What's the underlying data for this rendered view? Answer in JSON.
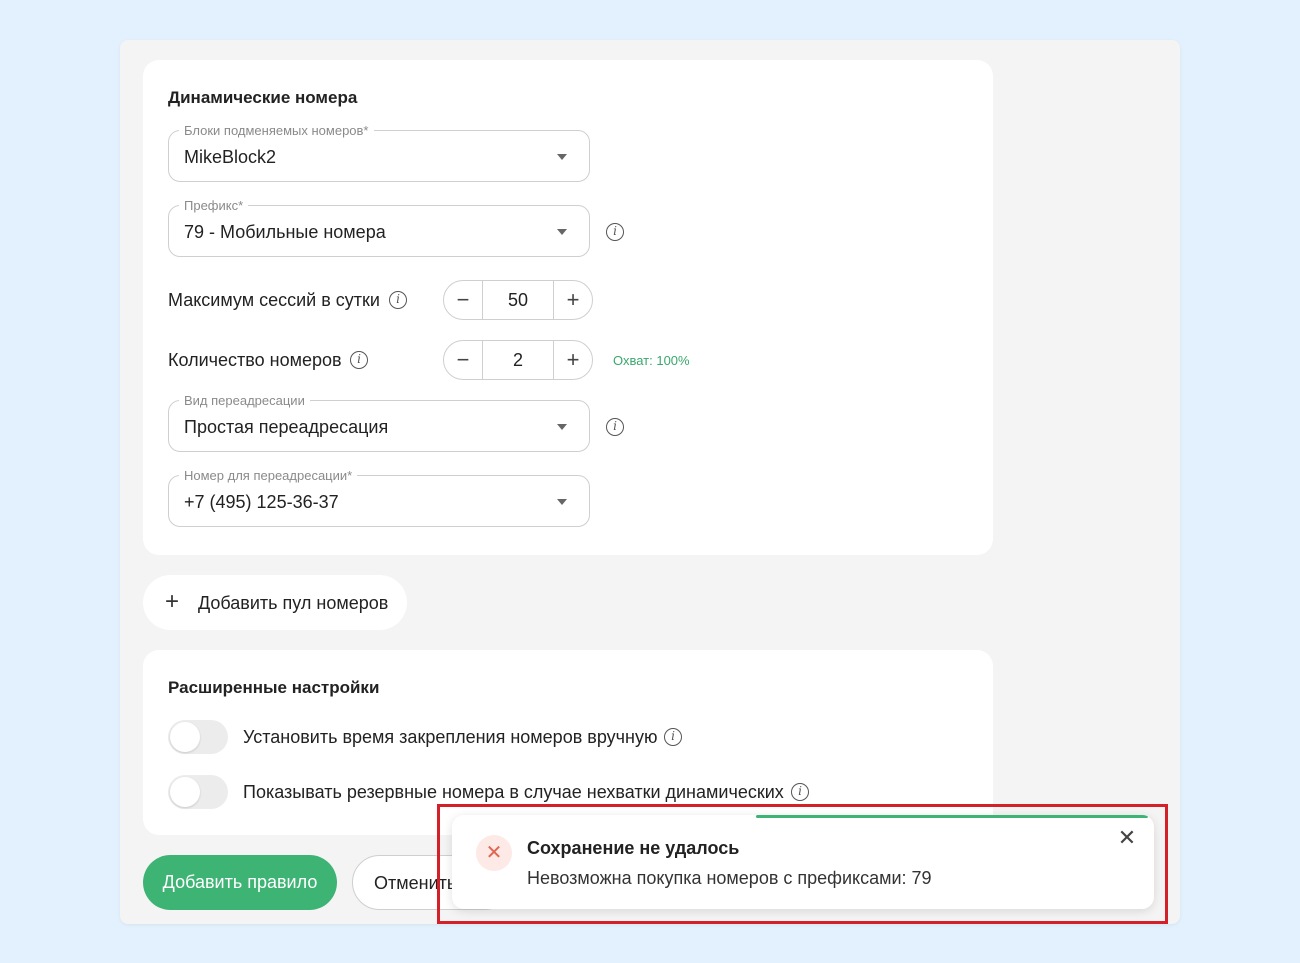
{
  "dynamic_section": {
    "title": "Динамические номера",
    "blocks_field": {
      "label": "Блоки подменяемых номеров*",
      "value": "MikeBlock2"
    },
    "prefix_field": {
      "label": "Префикс*",
      "value": "79 - Мобильные номера"
    },
    "max_sessions": {
      "label": "Максимум сессий в сутки",
      "value": "50"
    },
    "numbers_count": {
      "label": "Количество номеров",
      "value": "2",
      "coverage": "Охват: 100%"
    },
    "forward_type_field": {
      "label": "Вид переадресации",
      "value": "Простая переадресация"
    },
    "forward_number_field": {
      "label": "Номер для переадресации*",
      "value": "+7 (495) 125-36-37"
    }
  },
  "add_pool_label": "Добавить пул номеров",
  "advanced_section": {
    "title": "Расширенные настройки",
    "toggle_pin_time": {
      "label": "Установить время закрепления номеров вручную",
      "on": false
    },
    "toggle_reserve": {
      "label": "Показывать резервные номера в случае нехватки динамических",
      "on": false
    }
  },
  "actions": {
    "add_rule": "Добавить правило",
    "cancel": "Отменить"
  },
  "toast": {
    "title": "Сохранение не удалось",
    "message": "Невозможна покупка номеров с префиксами: 79",
    "progress_remaining": 0.57
  },
  "colors": {
    "accent": "#3db374",
    "error": "#e06650",
    "highlight": "#d32029",
    "background": "#e3f0fd"
  },
  "icons": {
    "info": "info-circle-icon",
    "caret": "chevron-down-icon",
    "close": "close-icon",
    "error": "error-x-icon",
    "plus": "plus-icon",
    "minus": "minus-icon"
  }
}
